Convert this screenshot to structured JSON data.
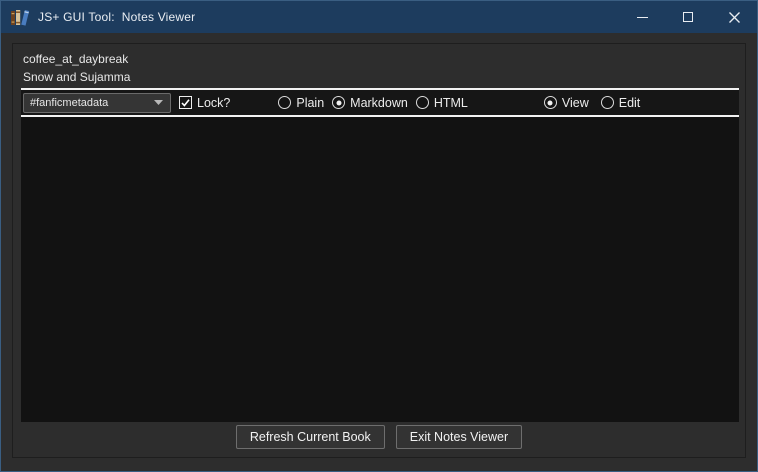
{
  "window": {
    "title": "JS+ GUI Tool:  Notes Viewer"
  },
  "header": {
    "book_title": "coffee_at_daybreak",
    "book_author": "Snow and Sujamma"
  },
  "toolbar": {
    "note_selector": {
      "value": "#fanficmetadata"
    },
    "lock_checkbox": {
      "label": "Lock?",
      "checked": true
    },
    "format_options": [
      {
        "label": "Plain",
        "selected": false
      },
      {
        "label": "Markdown",
        "selected": true
      },
      {
        "label": "HTML",
        "selected": false
      }
    ],
    "mode_options": [
      {
        "label": "View",
        "selected": true
      },
      {
        "label": "Edit",
        "selected": false
      }
    ]
  },
  "content": {
    "text": ""
  },
  "footer": {
    "refresh_button": "Refresh Current Book",
    "exit_button": "Exit Notes Viewer"
  },
  "colors": {
    "titlebar_bg": "#1d3c5e",
    "app_bg": "#2d2d2d",
    "toolbar_bg": "#161616",
    "content_bg": "#121212",
    "separator": "#f2f2f2",
    "window_border": "#3a5e82",
    "button_bg": "#333333",
    "button_border": "#6e6e6e"
  }
}
